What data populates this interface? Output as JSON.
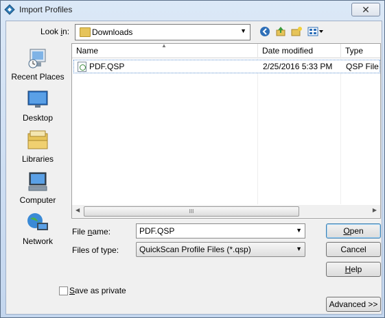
{
  "window": {
    "title": "Import Profiles",
    "close_glyph": "✕"
  },
  "look_in": {
    "label_prefix": "Look ",
    "label_accel": "i",
    "label_suffix": "n:",
    "value": "Downloads",
    "icons": [
      "back-icon",
      "up-folder-icon",
      "new-folder-icon",
      "view-menu-icon"
    ]
  },
  "places": [
    {
      "label": "Recent Places",
      "icon": "recent-places-icon"
    },
    {
      "label": "Desktop",
      "icon": "desktop-icon"
    },
    {
      "label": "Libraries",
      "icon": "libraries-icon"
    },
    {
      "label": "Computer",
      "icon": "computer-icon"
    },
    {
      "label": "Network",
      "icon": "network-icon"
    }
  ],
  "file_list": {
    "columns": [
      "Name",
      "Date modified",
      "Type"
    ],
    "rows": [
      {
        "name": "PDF.QSP",
        "date": "2/25/2016 5:33 PM",
        "type": "QSP File"
      }
    ],
    "scroll_thumb_glyph": "III"
  },
  "file_name": {
    "label_prefix": "File ",
    "label_accel": "n",
    "label_suffix": "ame:",
    "value": "PDF.QSP"
  },
  "file_type": {
    "label": "Files of type:",
    "value": "QuickScan Profile Files (*.qsp)"
  },
  "buttons": {
    "open_accel": "O",
    "open_rest": "pen",
    "cancel": "Cancel",
    "help_accel": "H",
    "help_rest": "elp",
    "advanced": "Advanced >>"
  },
  "save_private": {
    "label_accel": "S",
    "label_rest": "ave as private",
    "checked": false
  }
}
